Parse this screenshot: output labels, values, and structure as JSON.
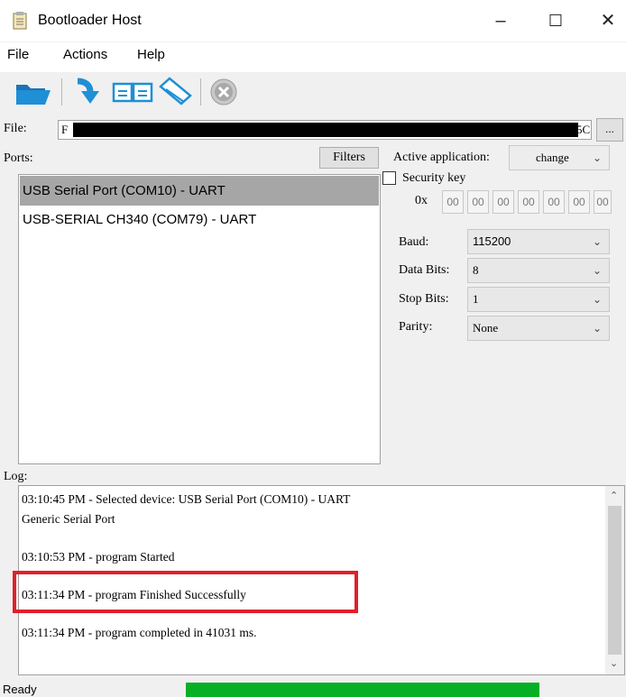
{
  "window": {
    "title": "Bootloader Host",
    "minimize": "–",
    "maximize": "☐",
    "close": "✕"
  },
  "menu": {
    "file": "File",
    "actions": "Actions",
    "help": "Help"
  },
  "toolbar": [
    "open-folder-icon",
    "download-arrow-icon",
    "copy-pages-icon",
    "erase-tag-icon",
    "abort-icon"
  ],
  "file": {
    "label": "File:",
    "value_start": "F",
    "value_end": "5C",
    "browse": "..."
  },
  "ports": {
    "label": "Ports:",
    "filters_button": "Filters",
    "items": [
      {
        "name": "USB Serial Port (COM10) - UART",
        "selected": true
      },
      {
        "name": "USB-SERIAL CH340 (COM79) - UART",
        "selected": false
      }
    ]
  },
  "active_application": {
    "label": "Active application:",
    "value": "change"
  },
  "security": {
    "label": "Security key",
    "prefix": "0x",
    "bytes": [
      "00",
      "00",
      "00",
      "00",
      "00",
      "00",
      "00"
    ]
  },
  "serial": {
    "baud": {
      "label": "Baud:",
      "value": "115200"
    },
    "data_bits": {
      "label": "Data Bits:",
      "value": "8"
    },
    "stop_bits": {
      "label": "Stop Bits:",
      "value": "1"
    },
    "parity": {
      "label": "Parity:",
      "value": "None"
    }
  },
  "log": {
    "label": "Log:",
    "lines": [
      "03:10:45 PM - Selected device: USB Serial Port (COM10) - UART",
      "Generic Serial Port",
      "03:10:53 PM - program Started",
      "03:11:34 PM - program Finished Successfully",
      "03:11:34 PM - program completed in 41031 ms."
    ]
  },
  "status": {
    "text": "Ready",
    "progress": 1.0
  },
  "colors": {
    "selected_row": "#a6a6a6",
    "progress": "#06b025",
    "highlight": "#e0202a",
    "folder": "#1f8fd6"
  }
}
